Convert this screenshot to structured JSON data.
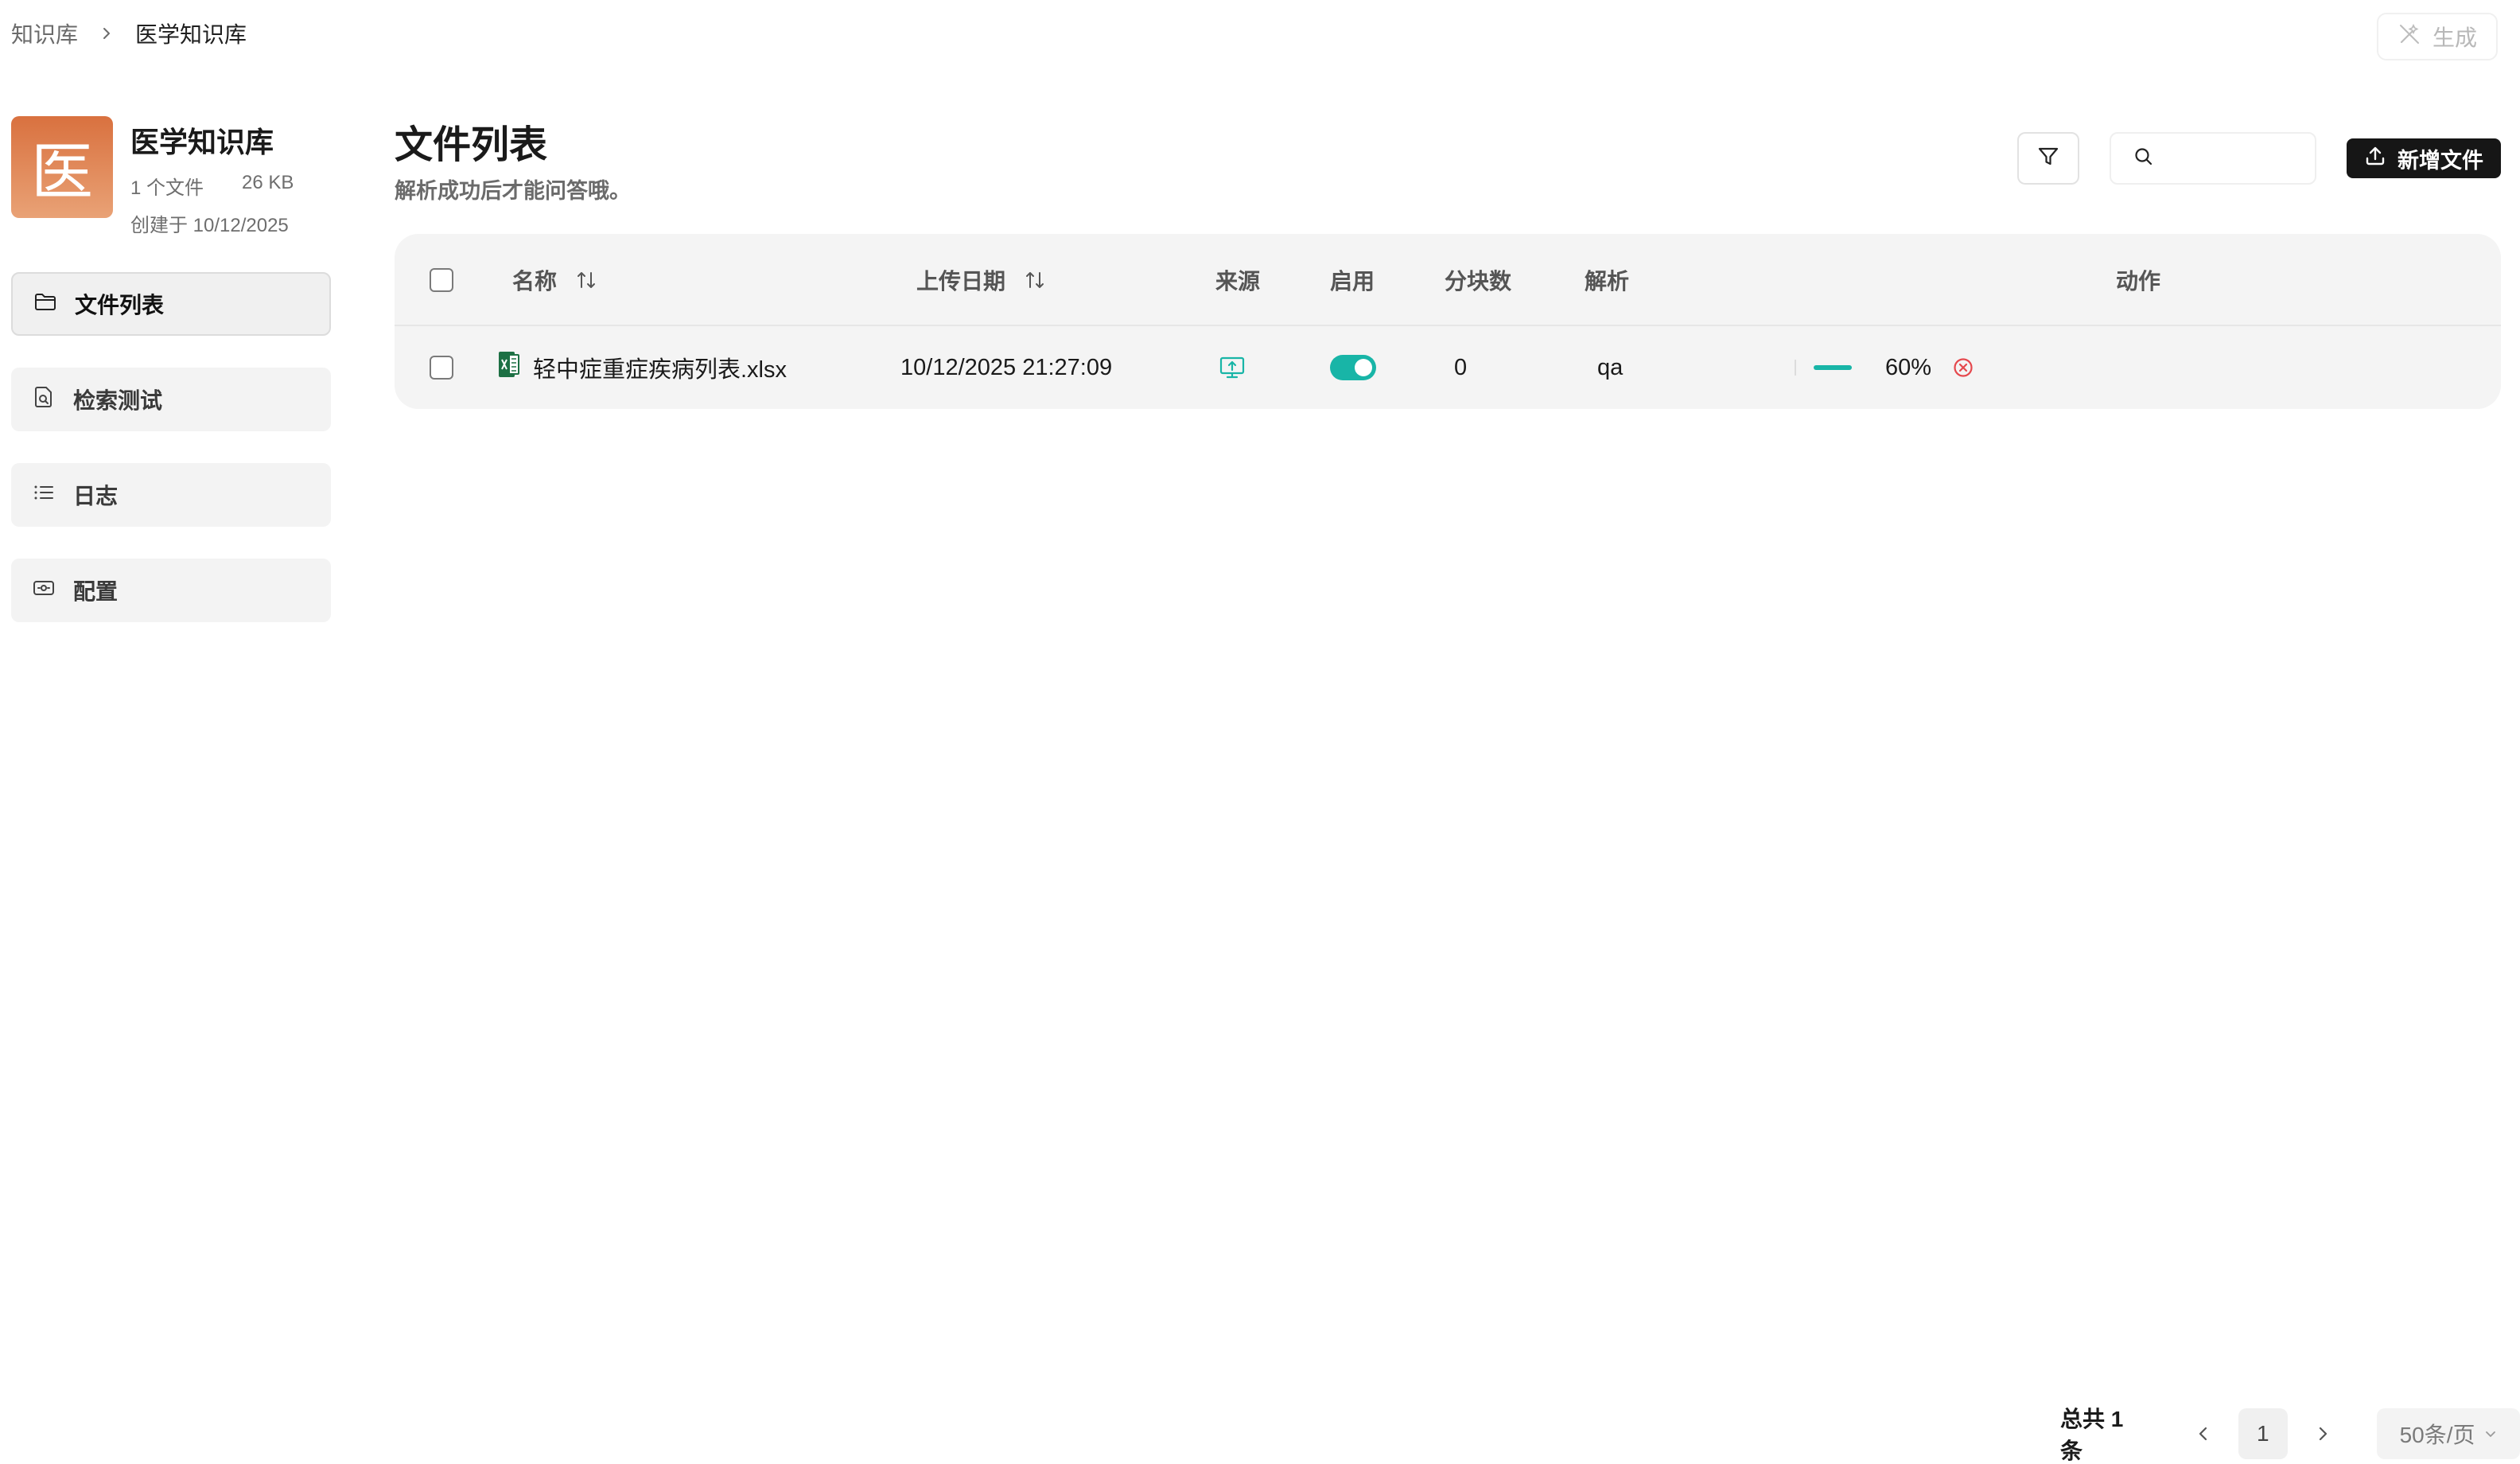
{
  "breadcrumb": {
    "root": "知识库",
    "current": "医学知识库"
  },
  "header": {
    "generate_label": "生成"
  },
  "knowledge_base": {
    "avatar_char": "医",
    "name": "医学知识库",
    "file_count": "1 个文件",
    "size": "26 KB",
    "created": "创建于 10/12/2025"
  },
  "sidebar": {
    "items": [
      {
        "label": "文件列表",
        "icon": "folder-icon",
        "active": true
      },
      {
        "label": "检索测试",
        "icon": "file-search-icon",
        "active": false
      },
      {
        "label": "日志",
        "icon": "list-icon",
        "active": false
      },
      {
        "label": "配置",
        "icon": "settings-card-icon",
        "active": false
      }
    ]
  },
  "main": {
    "title": "文件列表",
    "subtitle": "解析成功后才能问答哦。",
    "search_placeholder": "",
    "add_button_label": "新增文件"
  },
  "table": {
    "columns": {
      "name": "名称",
      "upload_date": "上传日期",
      "source": "来源",
      "enabled": "启用",
      "chunks": "分块数",
      "parse": "解析",
      "actions": "动作"
    },
    "rows": [
      {
        "name": "轻中症重症疾病列表.xlsx",
        "file_icon": "excel-file-icon",
        "upload_date": "10/12/2025 21:27:09",
        "source_icon": "local-upload-icon",
        "enabled": true,
        "chunks": "0",
        "parse_method": "qa",
        "progress": 0.6,
        "progress_text": "60%"
      }
    ]
  },
  "pagination": {
    "total": "总共 1 条",
    "current_page": "1",
    "page_size": "50条/页"
  },
  "colors": {
    "accent": "#18b5a7",
    "avatar_gradient_top": "#d9713f",
    "avatar_gradient_bottom": "#e9a276",
    "primary_button": "#161616",
    "danger": "#e5484d"
  }
}
